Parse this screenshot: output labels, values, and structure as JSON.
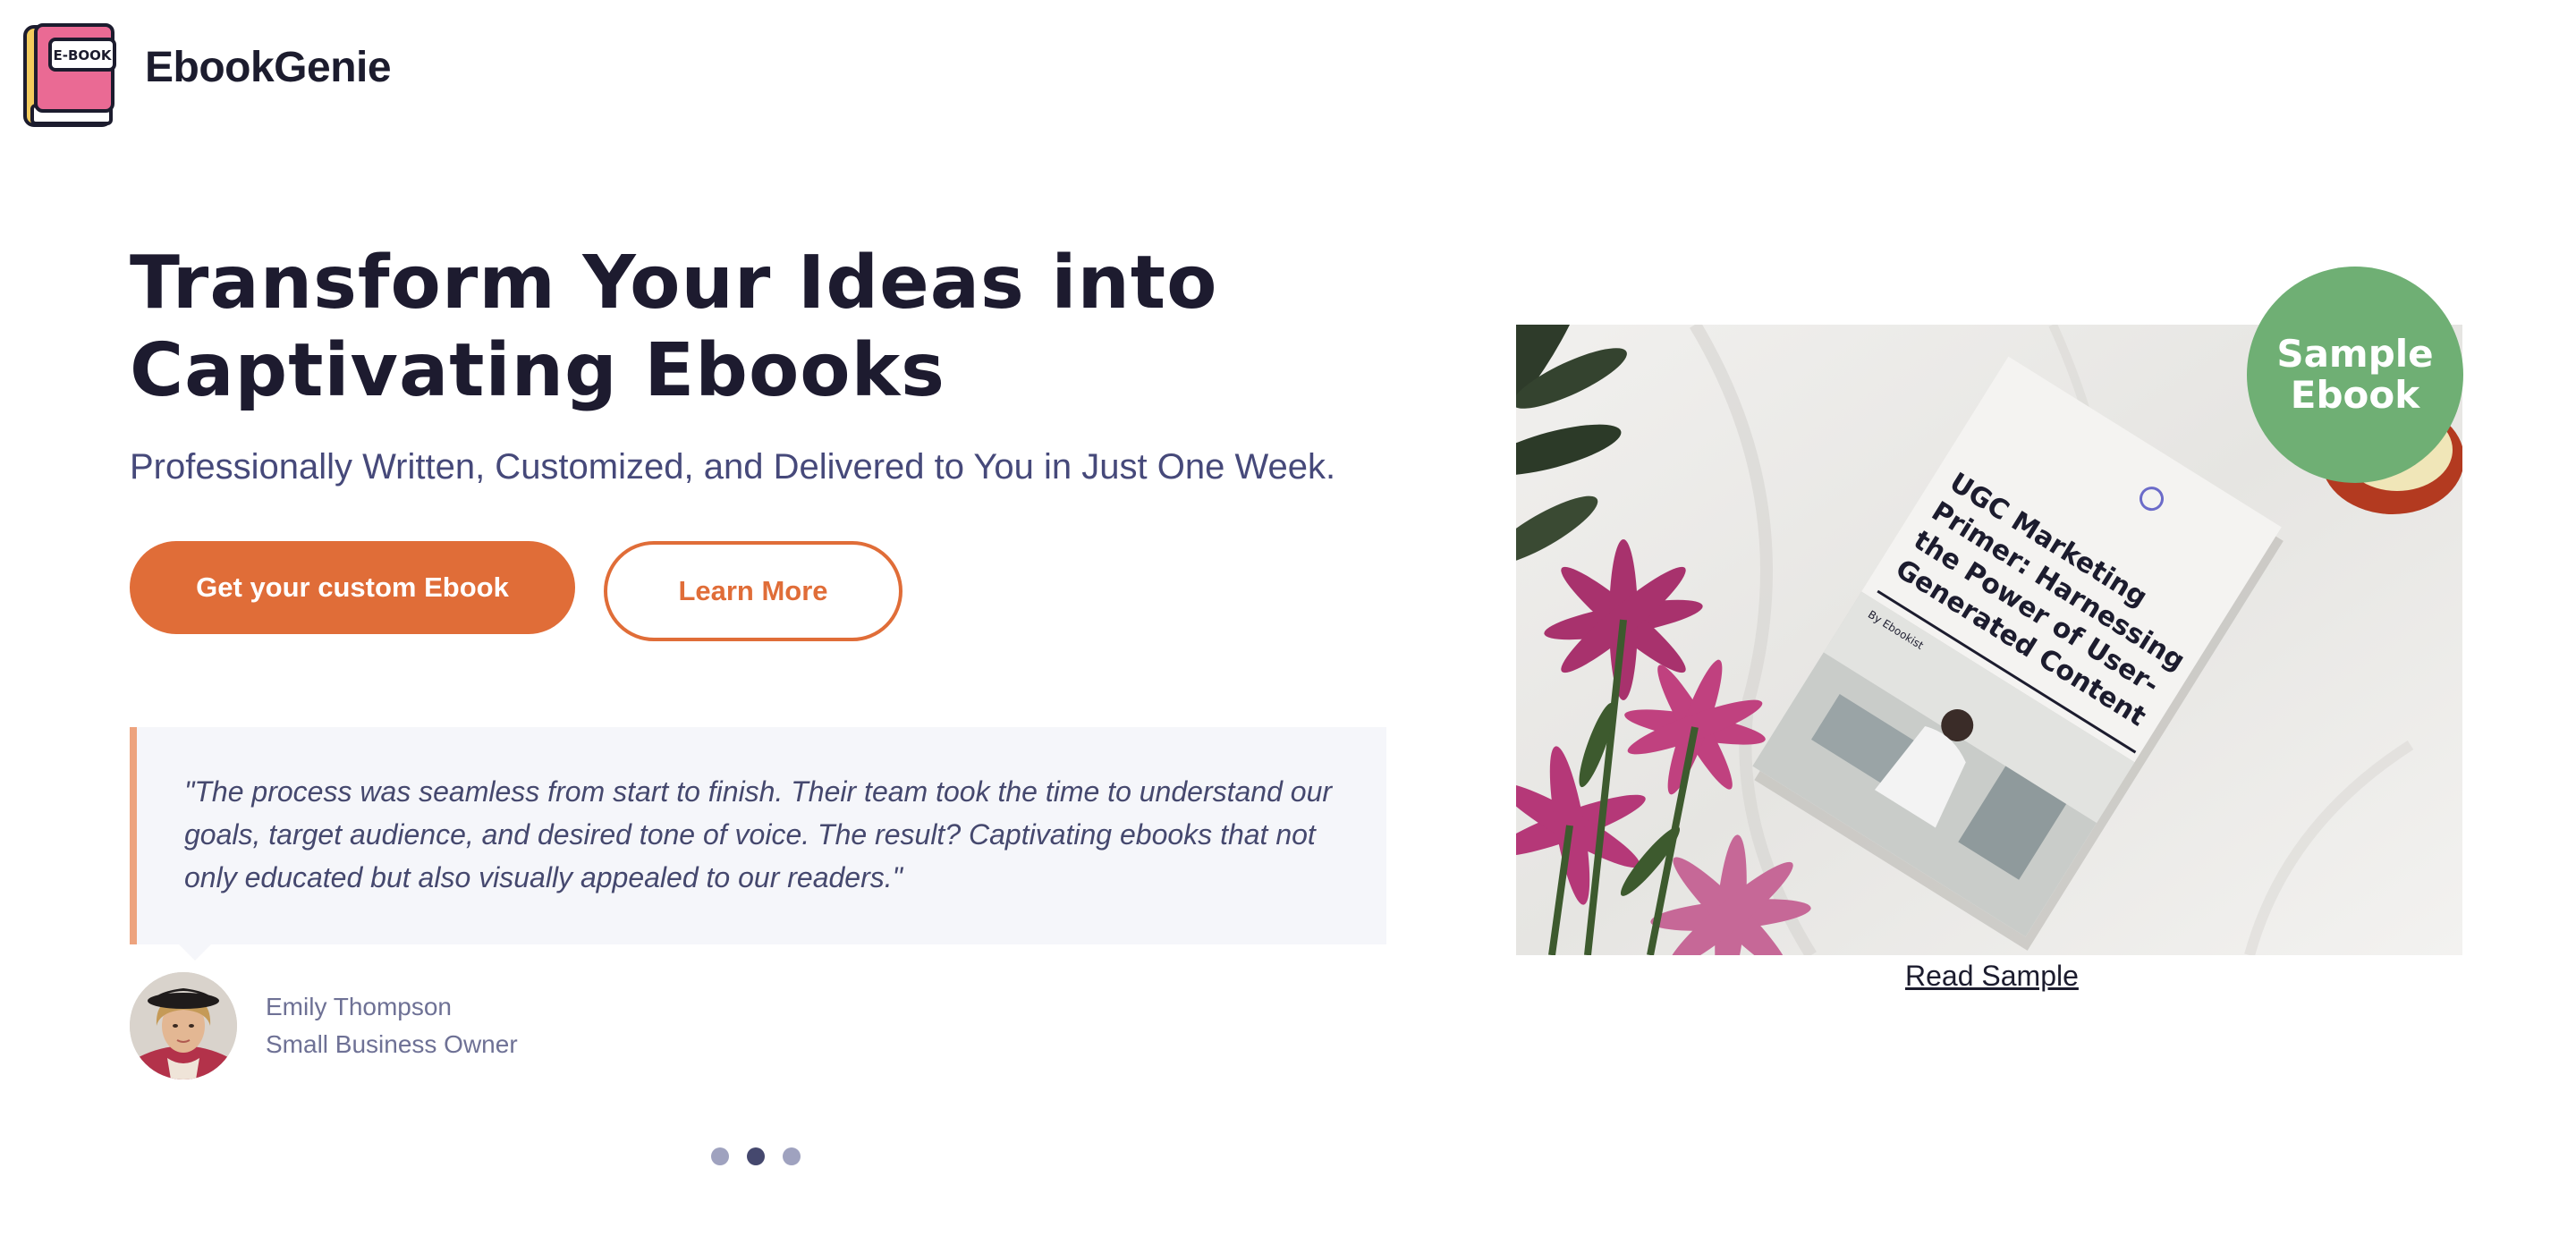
{
  "header": {
    "brand": "EbookGenie",
    "logo_label": "E-BOOK"
  },
  "hero": {
    "title_line1": "Transform Your Ideas into",
    "title_line2": "Captivating Ebooks",
    "subtitle": "Professionally Written, Customized, and Delivered to You in Just One Week.",
    "primary_button": "Get your custom Ebook",
    "secondary_button": "Learn More"
  },
  "testimonial": {
    "quote": "\"The process was seamless from start to finish. Their team took the time to understand our goals, target audience, and desired tone of voice. The result? Captivating ebooks that not only educated but also visually appealed to our readers.\"",
    "author_name": "Emily Thompson",
    "author_role": "Small Business Owner",
    "carousel_active_index": 1,
    "carousel_count": 3
  },
  "sample": {
    "badge_line1": "Sample",
    "badge_line2": "Ebook",
    "book_title_lines": [
      "UGC Marketing",
      "Primer: Harnessing",
      "the Power of User-",
      "Generated Content"
    ],
    "book_byline": "By Ebookist",
    "read_link": "Read Sample"
  },
  "colors": {
    "accent": "#e06d38",
    "badge": "#6faf74",
    "quote_border": "#eda37e",
    "quote_bg": "#f5f6fa",
    "text_dark": "#1d1b2f",
    "text_muted": "#46497a"
  }
}
